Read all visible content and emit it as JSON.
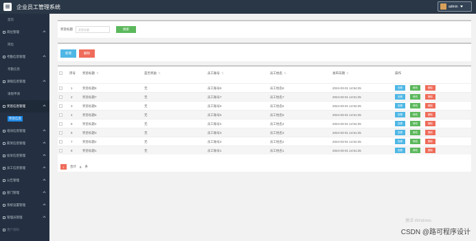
{
  "header": {
    "title": "企业员工管理系统",
    "user": "admin"
  },
  "sidebar": {
    "items": [
      {
        "label": "首页",
        "type": "sub"
      },
      {
        "label": "岗位管理",
        "type": "group"
      },
      {
        "label": "岗位",
        "type": "sub"
      },
      {
        "label": "考勤信息管理",
        "type": "group"
      },
      {
        "label": "考勤信息",
        "type": "sub"
      },
      {
        "label": "请假信息管理",
        "type": "group"
      },
      {
        "label": "请假申请",
        "type": "sub"
      },
      {
        "label": "奖惩信息管理",
        "type": "group",
        "active": true
      },
      {
        "label": "奖惩信息",
        "type": "sub",
        "active": true
      },
      {
        "label": "培训信息管理",
        "type": "group"
      },
      {
        "label": "薪资信息管理",
        "type": "group"
      },
      {
        "label": "投诉信息管理",
        "type": "group"
      },
      {
        "label": "员工信息管理",
        "type": "group"
      },
      {
        "label": "公告管理",
        "type": "group"
      },
      {
        "label": "部门管理",
        "type": "group"
      },
      {
        "label": "系统设置管理",
        "type": "group"
      },
      {
        "label": "管理员管理",
        "type": "group"
      },
      {
        "label": "用户资料",
        "type": "group"
      }
    ]
  },
  "search": {
    "label": "奖惩标题",
    "placeholder": "奖惩标题",
    "button": "搜索"
  },
  "actions": {
    "add": "新增",
    "delete": "删除"
  },
  "table": {
    "columns": [
      "序号",
      "奖惩标题",
      "是否奖励",
      "员工账号",
      "员工姓名",
      "发布日期",
      "操作"
    ],
    "rows": [
      {
        "no": "1",
        "title": "奖惩标题8",
        "reward": "无",
        "account": "员工账号8",
        "name": "员工姓名8",
        "date": "2024-03-01 14:54:25"
      },
      {
        "no": "2",
        "title": "奖惩标题7",
        "reward": "无",
        "account": "员工账号7",
        "name": "员工姓名7",
        "date": "2024-03-01 14:51:25"
      },
      {
        "no": "3",
        "title": "奖惩标题6",
        "reward": "无",
        "account": "员工账号6",
        "name": "员工姓名6",
        "date": "2024-03-01 14:54:25"
      },
      {
        "no": "4",
        "title": "奖惩标题5",
        "reward": "无",
        "account": "员工账号5",
        "name": "员工姓名5",
        "date": "2024-03-01 14:51:25"
      },
      {
        "no": "5",
        "title": "奖惩标题4",
        "reward": "无",
        "account": "员工账号4",
        "name": "员工姓名4",
        "date": "2024-03-01 14:54:25"
      },
      {
        "no": "6",
        "title": "奖惩标题3",
        "reward": "无",
        "account": "员工账号3",
        "name": "员工姓名3",
        "date": "2024-03-01 14:51:25"
      },
      {
        "no": "7",
        "title": "奖惩标题2",
        "reward": "无",
        "account": "员工账号2",
        "name": "员工姓名2",
        "date": "2024-03-01 14:54:25"
      },
      {
        "no": "8",
        "title": "奖惩标题1",
        "reward": "无",
        "account": "员工账号1",
        "name": "员工姓名1",
        "date": "2024-03-01 14:51:25"
      }
    ],
    "op_labels": {
      "view": "查看",
      "edit": "修改",
      "delete": "删除"
    }
  },
  "pager": {
    "current": "1",
    "total_prefix": "合计",
    "total": "8",
    "total_suffix": "条"
  },
  "overlay": {
    "watermark": "CSDN @路可程序设计",
    "windows": "激活 Windows"
  },
  "colors": {
    "topbar": "#2a3746",
    "sidebar": "#243041",
    "primary": "#4fb7e5",
    "success": "#5cb85c",
    "danger": "#ef6c5a"
  }
}
